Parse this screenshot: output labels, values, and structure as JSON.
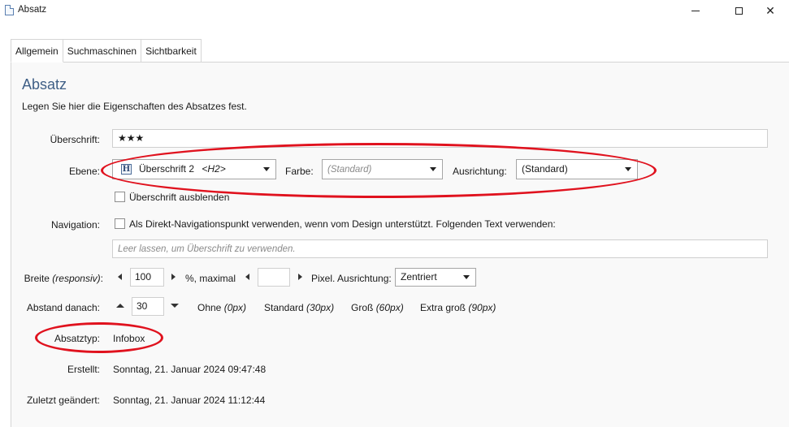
{
  "window": {
    "title": "Absatz",
    "minimize": "—",
    "maximize": "☐",
    "close": "✕"
  },
  "tabs": [
    {
      "label": "Allgemein",
      "active": true
    },
    {
      "label": "Suchmaschinen",
      "active": false
    },
    {
      "label": "Sichtbarkeit",
      "active": false
    }
  ],
  "section": {
    "heading": "Absatz",
    "description": "Legen Sie hier die Eigenschaften des Absatzes fest."
  },
  "form": {
    "ueberschrift_label": "Überschrift:",
    "ueberschrift_value": "★★★",
    "ebene_label": "Ebene:",
    "ebene_icon_letter": "H",
    "ebene_value": "Überschrift 2",
    "ebene_tag": "<H2>",
    "farbe_label": "Farbe:",
    "farbe_value": "(Standard)",
    "ausrichtung_label": "Ausrichtung:",
    "ausrichtung_value": "(Standard)",
    "hide_heading_label": "Überschrift ausblenden",
    "navigation_label": "Navigation:",
    "navigation_checkbox_label": "Als Direkt-Navigationspunkt verwenden, wenn vom Design unterstützt. Folgenden Text verwenden:",
    "navigation_placeholder": "Leer lassen, um Überschrift zu verwenden.",
    "breite_label_main": "Breite ",
    "breite_label_em": "(responsiv)",
    "breite_label_colon": ":",
    "breite_value": "100",
    "breite_unit": "%, maximal",
    "breite_max_value": "",
    "pixel_ausrichtung_label": "Pixel. Ausrichtung:",
    "pixel_ausrichtung_value": "Zentriert",
    "abstand_label": "Abstand danach:",
    "abstand_value": "30",
    "abstand_presets": [
      {
        "name": "Ohne",
        "value": "(0px)"
      },
      {
        "name": "Standard",
        "value": "(30px)"
      },
      {
        "name": "Groß",
        "value": "(60px)"
      },
      {
        "name": "Extra groß",
        "value": "(90px)"
      }
    ],
    "absatztyp_label": "Absatztyp:",
    "absatztyp_value": "Infobox",
    "erstellt_label": "Erstellt:",
    "erstellt_value": "Sonntag, 21. Januar 2024 09:47:48",
    "geaendert_label": "Zuletzt geändert:",
    "geaendert_value": "Sonntag, 21. Januar 2024 11:12:44"
  },
  "colors": {
    "heading": "#3f5f86",
    "annotation": "#e0121e",
    "panel_bg": "#f9f9f9"
  }
}
